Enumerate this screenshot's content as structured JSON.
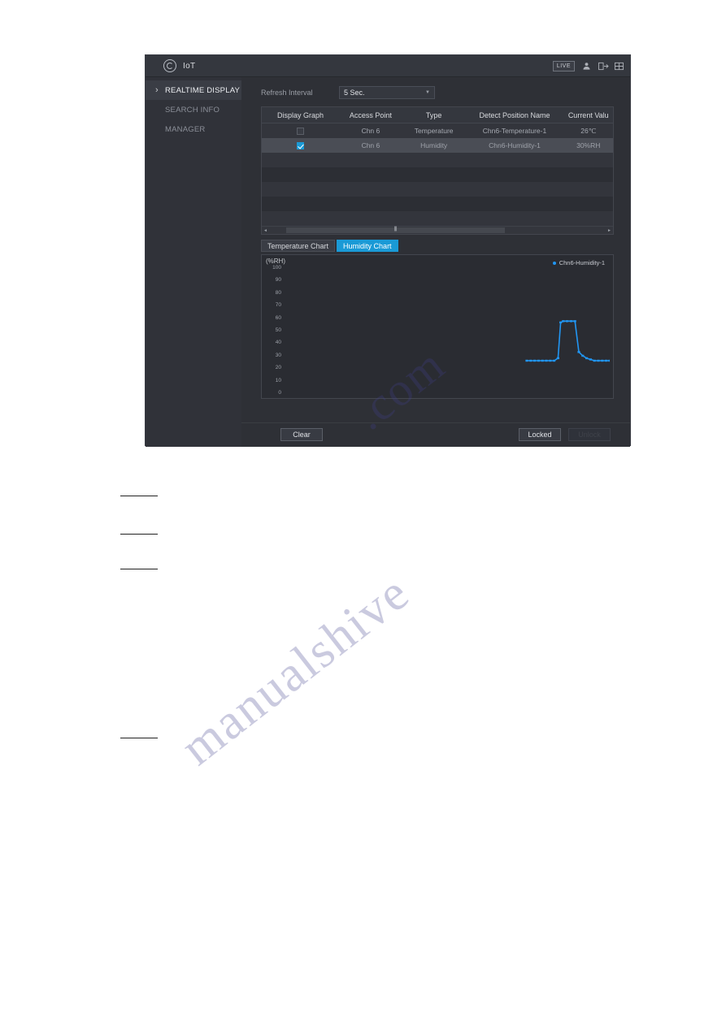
{
  "window": {
    "app_title": "IoT",
    "app_icon": "iot-globe-icon",
    "live_badge": "LIVE",
    "header_icons": [
      "user-icon",
      "logout-icon",
      "layout-grid-icon"
    ]
  },
  "sidebar": {
    "items": [
      {
        "label": "REALTIME DISPLAY",
        "active": true
      },
      {
        "label": "SEARCH INFO",
        "active": false
      },
      {
        "label": "MANAGER",
        "active": false
      }
    ]
  },
  "main": {
    "refresh": {
      "label": "Refresh Interval",
      "selected": "5 Sec."
    },
    "table": {
      "headers": [
        "Display Graph",
        "Access Point",
        "Type",
        "Detect Position Name",
        "Current Valu"
      ],
      "rows": [
        {
          "checked": false,
          "access_point": "Chn 6",
          "type": "Temperature",
          "position_name": "Chn6-Temperature-1",
          "current_value": "26℃",
          "selected": false
        },
        {
          "checked": true,
          "access_point": "Chn 6",
          "type": "Humidity",
          "position_name": "Chn6-Humidity-1",
          "current_value": "30%RH",
          "selected": true
        }
      ],
      "empty_row_count": 7
    },
    "tabs": [
      {
        "label": "Temperature Chart",
        "active": false
      },
      {
        "label": "Humidity Chart",
        "active": true
      }
    ]
  },
  "footer": {
    "clear_label": "Clear",
    "locked_label": "Locked",
    "unlock_label": "Unlock"
  },
  "colors": {
    "accent": "#1a9ad6",
    "series": "#2196f3",
    "panel": "#2e3036",
    "titlebar": "#34373e",
    "sidebar": "#303239"
  },
  "chart_data": {
    "type": "line",
    "title": "Humidity Chart",
    "ylabel": "(%RH)",
    "xlabel": "",
    "ylim": [
      0,
      100
    ],
    "yticks": [
      100,
      90,
      80,
      70,
      60,
      50,
      40,
      30,
      20,
      10,
      0
    ],
    "grid": false,
    "legend": [
      "Chn6-Humidity-1"
    ],
    "legend_position": "top-right",
    "x_start_fraction": 0.74,
    "series": [
      {
        "name": "Chn6-Humidity-1",
        "color": "#2196f3",
        "x": [
          0.745,
          0.757,
          0.769,
          0.781,
          0.793,
          0.805,
          0.817,
          0.829,
          0.841,
          0.849,
          0.857,
          0.869,
          0.881,
          0.893,
          0.905,
          0.917,
          0.929,
          0.941,
          0.953,
          0.965,
          0.977,
          0.989,
          1.0
        ],
        "values": [
          25,
          25,
          25,
          25,
          25,
          25,
          25,
          25,
          27,
          56,
          57,
          57,
          57,
          57,
          32,
          29,
          27,
          26,
          25,
          25,
          25,
          25,
          25
        ]
      }
    ]
  }
}
